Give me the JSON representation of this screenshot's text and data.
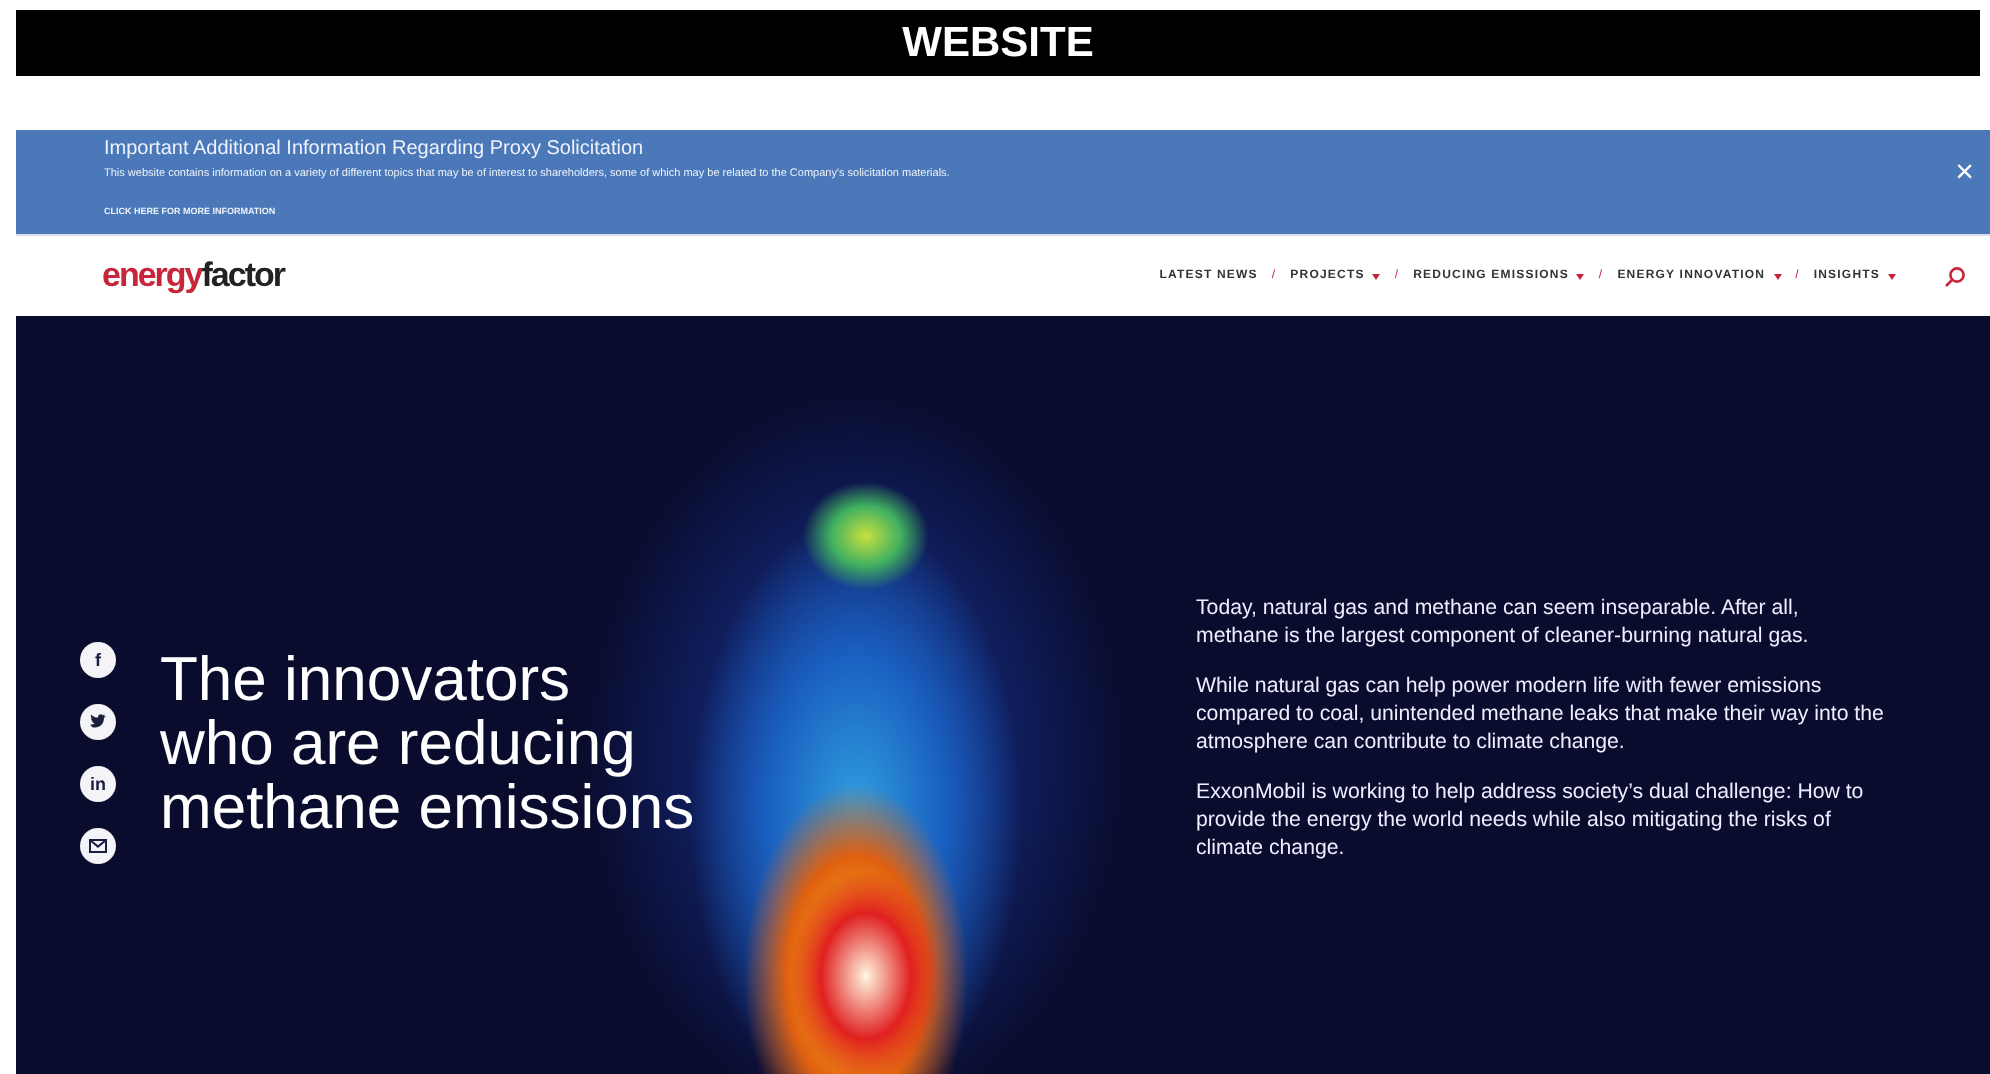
{
  "frame_title": "WEBSITE",
  "notice": {
    "title": "Important Additional Information Regarding Proxy Solicitation",
    "body": "This website contains information on a variety of different topics that may be of interest to shareholders, some of which may be related to the Company's solicitation materials.",
    "link": "CLICK HERE FOR MORE INFORMATION",
    "close": "×"
  },
  "logo": {
    "prefix": "energy",
    "suffix": "factor"
  },
  "nav": {
    "items": [
      {
        "label": "LATEST NEWS",
        "dropdown": false
      },
      {
        "label": "PROJECTS",
        "dropdown": true
      },
      {
        "label": "REDUCING EMISSIONS",
        "dropdown": true
      },
      {
        "label": "ENERGY INNOVATION",
        "dropdown": true
      },
      {
        "label": "INSIGHTS",
        "dropdown": true
      }
    ],
    "separators": [
      "/",
      "/",
      "/",
      "/"
    ]
  },
  "hero": {
    "social": [
      {
        "kind": "facebook",
        "glyph": "f"
      },
      {
        "kind": "twitter"
      },
      {
        "kind": "linkedin",
        "glyph": "in"
      },
      {
        "kind": "email"
      }
    ],
    "heading": "The innovators\nwho are reducing\nmethane emissions",
    "paragraphs": [
      "Today, natural gas and methane can seem inseparable. After all, methane is the largest component of cleaner-burning natural gas.",
      "While natural gas can help power modern life with fewer emissions compared to coal, unintended methane leaks that make their way into the atmosphere can contribute to climate change.",
      "ExxonMobil is working to help address society’s dual challenge: How to provide the energy the world needs while also mitigating the risks of climate change."
    ]
  }
}
